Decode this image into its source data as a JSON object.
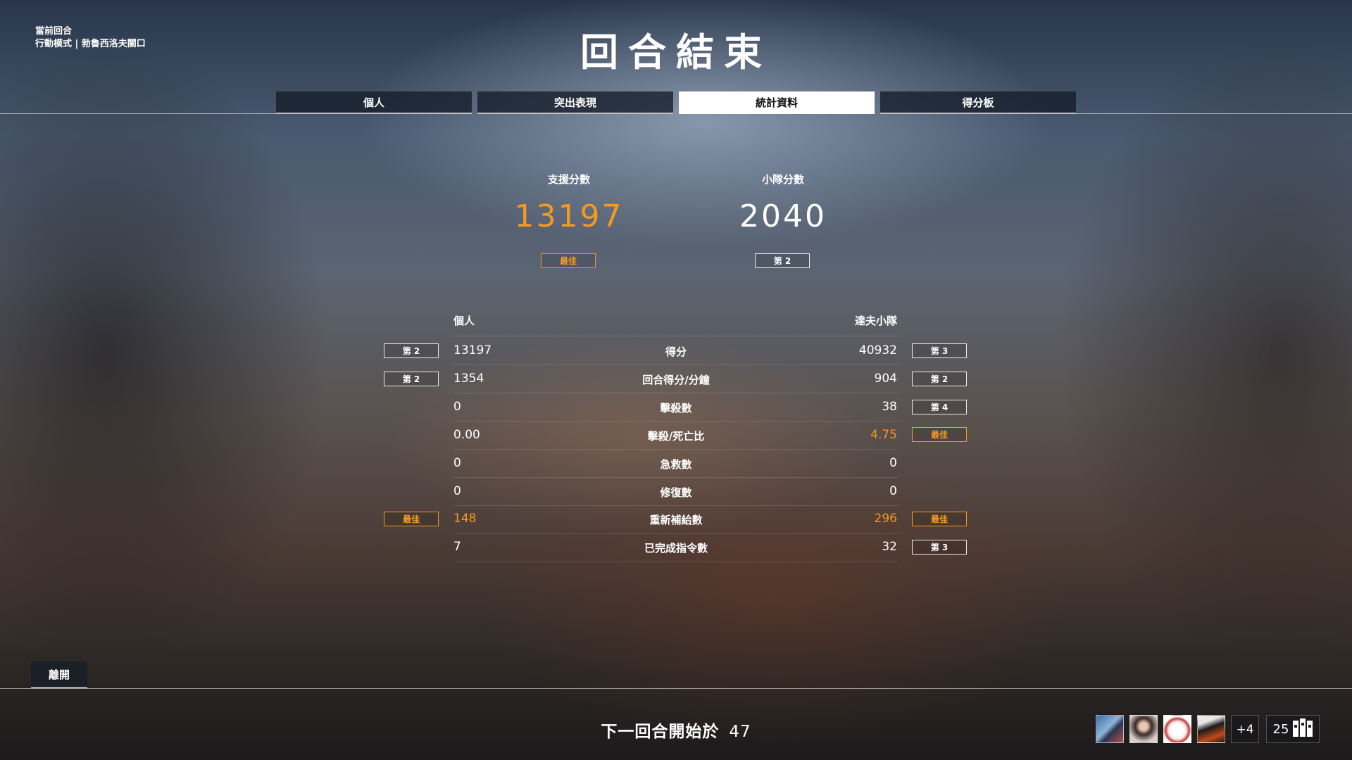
{
  "round_info": {
    "label": "當前回合",
    "mode_map": "行動模式 | 勃魯西洛夫關口"
  },
  "title": "回合結束",
  "tabs": [
    {
      "label": "個人",
      "active": false
    },
    {
      "label": "突出表現",
      "active": false
    },
    {
      "label": "統計資料",
      "active": true
    },
    {
      "label": "得分板",
      "active": false
    }
  ],
  "summary": {
    "support": {
      "label": "支援分數",
      "value": "13197",
      "rank": "最佳"
    },
    "squad": {
      "label": "小隊分數",
      "value": "2040",
      "rank": "第 2"
    }
  },
  "stats": {
    "left_header": "個人",
    "right_header": "達夫小隊",
    "rows": [
      {
        "label": "得分",
        "personal": "13197",
        "squad": "40932",
        "personal_rank": "第 2",
        "squad_rank": "第 3"
      },
      {
        "label": "回合得分/分鐘",
        "personal": "1354",
        "squad": "904",
        "personal_rank": "第 2",
        "squad_rank": "第 2"
      },
      {
        "label": "擊殺數",
        "personal": "0",
        "squad": "38",
        "personal_rank": "",
        "squad_rank": "第 4"
      },
      {
        "label": "擊殺/死亡比",
        "personal": "0.00",
        "squad": "4.75",
        "personal_rank": "",
        "squad_rank": "最佳"
      },
      {
        "label": "急救數",
        "personal": "0",
        "squad": "0",
        "personal_rank": "",
        "squad_rank": ""
      },
      {
        "label": "修復數",
        "personal": "0",
        "squad": "0",
        "personal_rank": "",
        "squad_rank": ""
      },
      {
        "label": "重新補給數",
        "personal": "148",
        "squad": "296",
        "personal_rank": "最佳",
        "squad_rank": "最佳"
      },
      {
        "label": "已完成指令數",
        "personal": "7",
        "squad": "32",
        "personal_rank": "",
        "squad_rank": "第 3"
      }
    ]
  },
  "leave_button": "離開",
  "next_round": {
    "label": "下一回合開始於",
    "countdown": "47"
  },
  "squad_members": {
    "extra": "+4",
    "count": "25"
  },
  "colors": {
    "accent": "#f39a1f",
    "panel": "#141c28"
  },
  "icons": [
    "avatar-1",
    "avatar-2",
    "avatar-3",
    "avatar-4",
    "players-icon"
  ]
}
